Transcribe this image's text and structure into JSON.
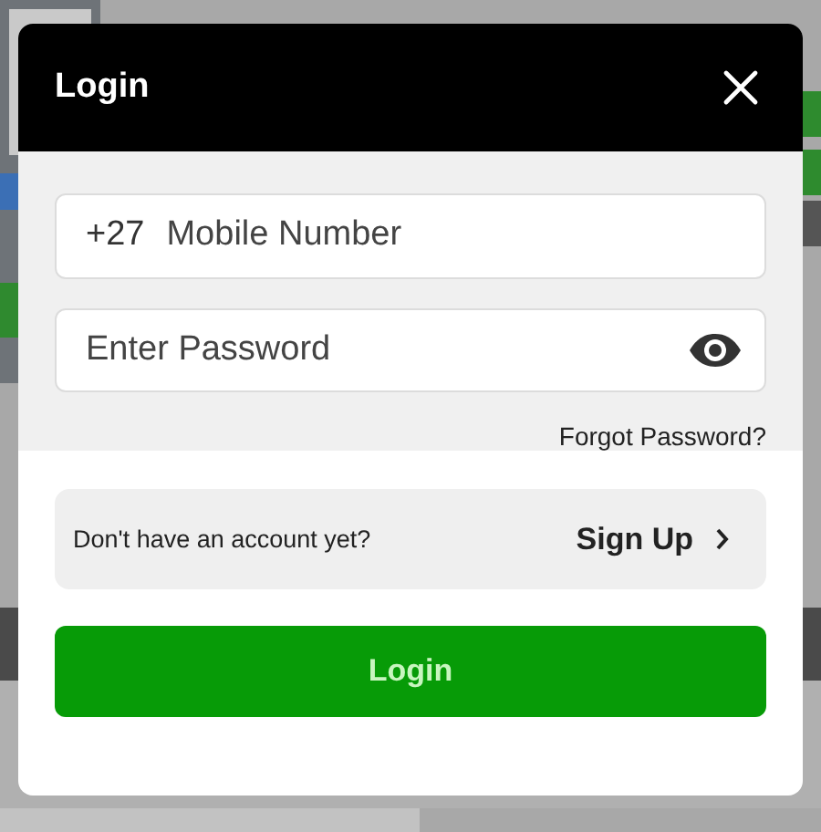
{
  "dialog": {
    "title": "Login",
    "phone_field": {
      "prefix": "+27",
      "placeholder": "Mobile Number"
    },
    "password_field": {
      "placeholder": "Enter Password"
    },
    "forgot_link": "Forgot Password?",
    "signup_prompt": {
      "text": "Don't have an account yet?",
      "action": "Sign Up"
    },
    "submit_button": "Login"
  }
}
